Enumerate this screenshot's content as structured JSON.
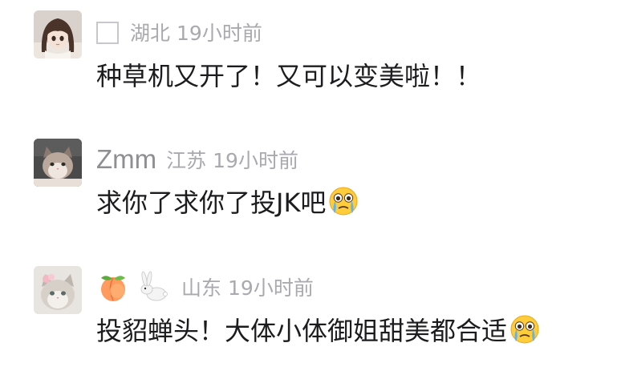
{
  "comments": [
    {
      "username": "",
      "name_icon": "empty-glyph-box",
      "location": "湖北",
      "time": "19小时前",
      "text": "种草机又开了！又可以变美啦！！",
      "avatar": "anime-girl-avatar"
    },
    {
      "username": "Zmm",
      "location": "江苏",
      "time": "19小时前",
      "text": "求你了求你了投JK吧",
      "text_emoji": "crying-face-emoji",
      "avatar": "cat-avatar"
    },
    {
      "username": "",
      "name_emojis": [
        "peach-emoji",
        "rabbit-emoji"
      ],
      "location": "山东",
      "time": "19小时前",
      "text": "投貂蝉头！大体小体御姐甜美都合适",
      "text_emoji": "crying-face-emoji",
      "avatar": "cat-with-bow-avatar"
    }
  ],
  "colors": {
    "username": "#8e8e93",
    "meta": "#a9a9ae",
    "text": "#1c1c1e"
  }
}
